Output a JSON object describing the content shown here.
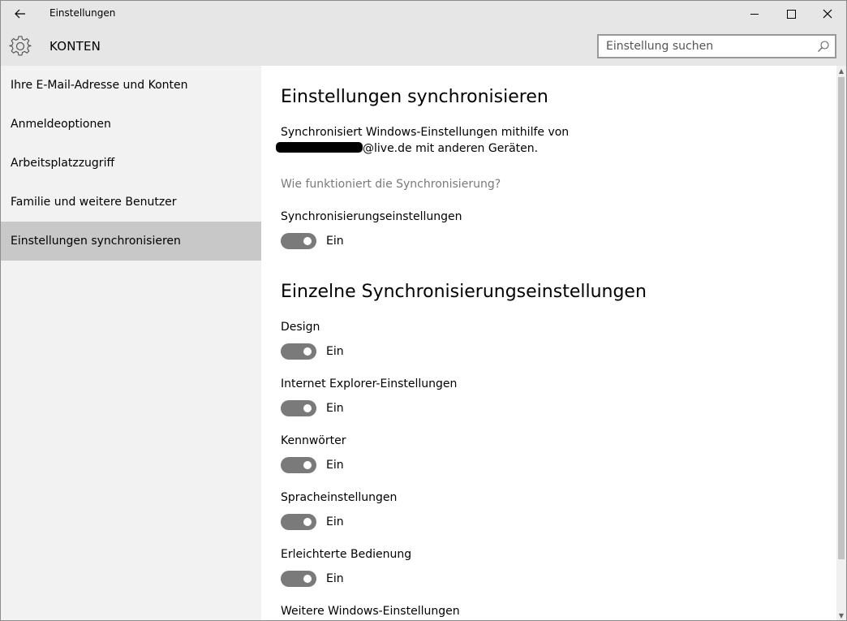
{
  "window": {
    "title": "Einstellungen",
    "back_icon": "arrow-left-icon",
    "minimize_icon": "minimize-icon",
    "maximize_icon": "maximize-icon",
    "close_icon": "close-icon"
  },
  "header": {
    "icon": "gear-icon",
    "title": "KONTEN",
    "search_placeholder": "Einstellung suchen",
    "search_icon": "search-icon"
  },
  "sidebar": {
    "items": [
      {
        "label": "Ihre E-Mail-Adresse und Konten",
        "active": false
      },
      {
        "label": "Anmeldeoptionen",
        "active": false
      },
      {
        "label": "Arbeitsplatzzugriff",
        "active": false
      },
      {
        "label": "Familie und weitere Benutzer",
        "active": false
      },
      {
        "label": "Einstellungen synchronisieren",
        "active": true
      }
    ],
    "active_color": "#c8c8c8"
  },
  "main": {
    "heading": "Einstellungen synchronisieren",
    "description_line1": "Synchronisiert Windows-Einstellungen mithilfe von",
    "description_line2_suffix": "@live.de mit anderen Geräten.",
    "help_link": "Wie funktioniert die Synchronisierung?",
    "sync_settings": {
      "label": "Synchronisierungseinstellungen",
      "state": "Ein"
    },
    "individual_heading": "Einzelne Synchronisierungseinstellungen",
    "individual": [
      {
        "label": "Design",
        "state": "Ein"
      },
      {
        "label": "Internet Explorer-Einstellungen",
        "state": "Ein"
      },
      {
        "label": "Kennwörter",
        "state": "Ein"
      },
      {
        "label": "Spracheinstellungen",
        "state": "Ein"
      },
      {
        "label": "Erleichterte Bedienung",
        "state": "Ein"
      }
    ],
    "more_label": "Weitere Windows-Einstellungen"
  },
  "colors": {
    "chrome_background": "#e6e6e6",
    "sidebar_background": "#f2f2f2",
    "toggle_on": "#7a7a7a",
    "link_text": "#7a7a7a"
  }
}
